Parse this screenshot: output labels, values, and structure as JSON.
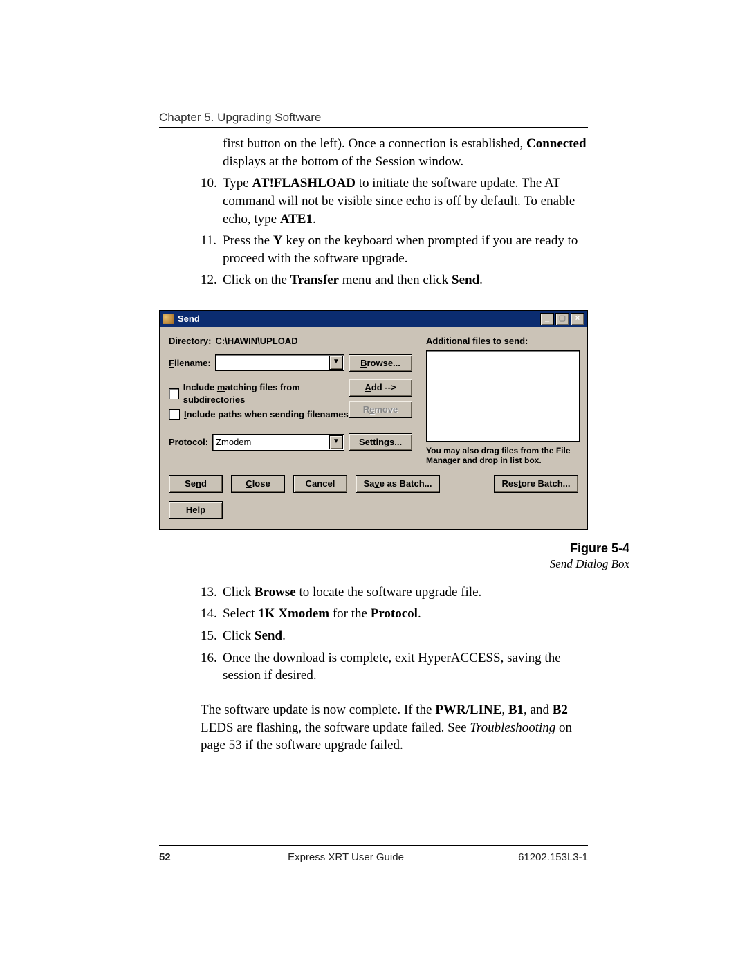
{
  "chapter": "Chapter 5. Upgrading Software",
  "intro_fragment": {
    "pre": "first button on the left).  Once a connection is established, ",
    "bold": "Connected",
    "post": " displays at the bottom of the Session window."
  },
  "steps_a": [
    {
      "n": "10.",
      "pre": "Type ",
      "b1": "AT!FLASHLOAD",
      "mid": " to initiate the software update.  The AT command will not be visible since echo is off by default.  To enable echo, type ",
      "b2": "ATE1",
      "post": "."
    },
    {
      "n": "11.",
      "pre": "Press the ",
      "b1": "Y",
      "mid": " key on the keyboard when prompted if you are ready to proceed with the software upgrade.",
      "b2": "",
      "post": ""
    },
    {
      "n": "12.",
      "pre": "Click on the ",
      "b1": "Transfer",
      "mid": " menu and then click ",
      "b2": "Send",
      "post": "."
    }
  ],
  "dialog": {
    "title": "Send",
    "directory_label": "Directory:",
    "directory_value": "C:\\HAWIN\\UPLOAD",
    "filename_label": "Filename:",
    "filename_value": "",
    "browse": "Browse...",
    "chk1": "Include matching files from subdirectories",
    "chk2": "Include paths when sending filenames",
    "add": "Add -->",
    "remove": "Remove",
    "protocol_label": "Protocol:",
    "protocol_value": "Zmodem",
    "settings": "Settings...",
    "additional_label": "Additional files to send:",
    "hint": "You may also drag files from the File Manager and drop in list box.",
    "btn_send": "Send",
    "btn_close": "Close",
    "btn_cancel": "Cancel",
    "btn_save_batch": "Save as Batch...",
    "btn_restore": "Restore Batch...",
    "btn_help": "Help",
    "min": "_",
    "max": "▢",
    "close": "×"
  },
  "figure": {
    "title": "Figure 5-4",
    "sub": "Send Dialog Box"
  },
  "steps_b": [
    {
      "n": "13.",
      "pre": "Click ",
      "b1": "Browse",
      "mid": " to locate the software upgrade file.",
      "b2": "",
      "post": ""
    },
    {
      "n": "14.",
      "pre": "Select ",
      "b1": "1K Xmodem",
      "mid": " for the ",
      "b2": "Protocol",
      "post": "."
    },
    {
      "n": "15.",
      "pre": "Click ",
      "b1": "Send",
      "mid": ".",
      "b2": "",
      "post": ""
    },
    {
      "n": "16.",
      "pre": "Once the download is complete, exit HyperACCESS, saving the session if desired.",
      "b1": "",
      "mid": "",
      "b2": "",
      "post": ""
    }
  ],
  "closing": {
    "p1a": "The software update is now complete.  If the ",
    "b1": "PWR/LINE",
    "c1": ", ",
    "b2": "B1",
    "c2": ", and ",
    "b3": "B2",
    "c3": " LEDS are flashing, the software update failed. See ",
    "i1": "Troubleshooting",
    "p2": " on page 53 if the software upgrade failed."
  },
  "footer": {
    "page": "52",
    "guide": "Express XRT User Guide",
    "doc": "61202.153L3-1"
  }
}
